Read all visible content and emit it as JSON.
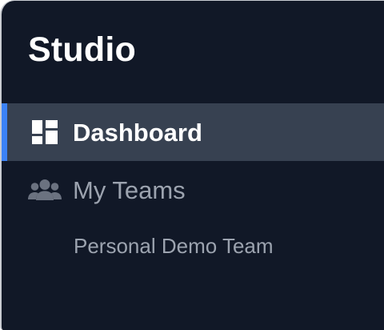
{
  "sidebar": {
    "brand": "Studio",
    "items": [
      {
        "label": "Dashboard",
        "icon": "dashboard-icon",
        "active": true
      },
      {
        "label": "My Teams",
        "icon": "users-icon",
        "active": false
      }
    ],
    "sub_items": [
      {
        "label": "Personal Demo Team"
      }
    ]
  },
  "colors": {
    "background": "#111827",
    "active_item": "#374151",
    "accent": "#3b82f6",
    "muted_text": "#9ca3af"
  }
}
